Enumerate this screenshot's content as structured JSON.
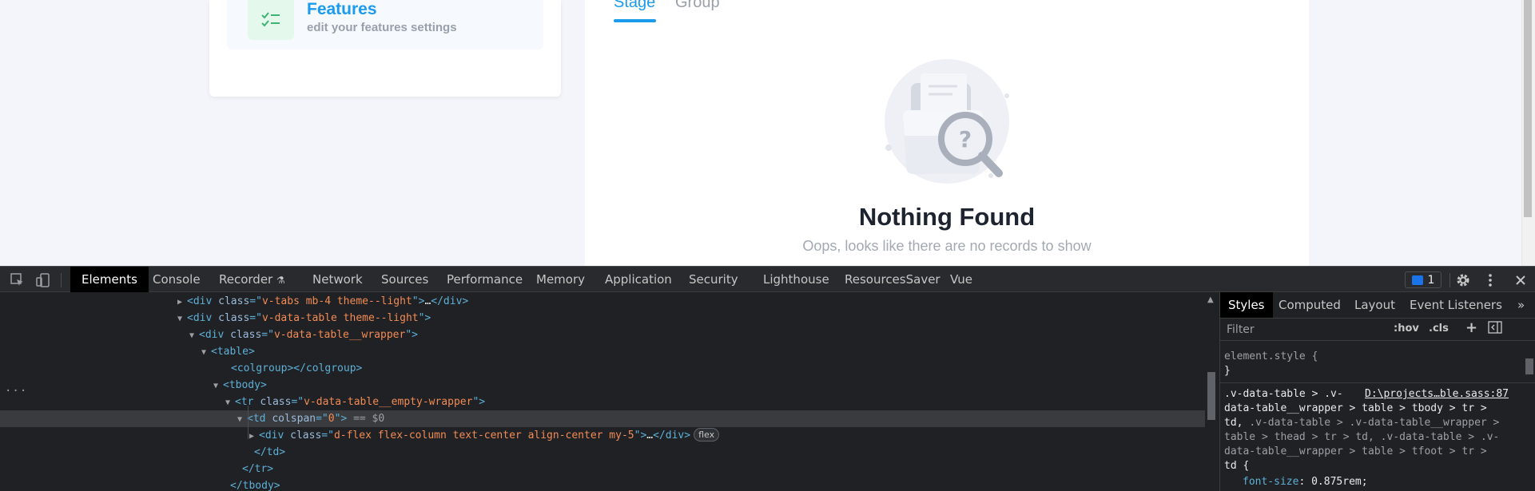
{
  "page": {
    "feature": {
      "title": "Features",
      "subtitle": "edit your features settings",
      "icon": "checklist-icon"
    },
    "tabs": [
      {
        "label": "Stage",
        "active": true
      },
      {
        "label": "Group",
        "active": false
      }
    ],
    "empty_state": {
      "title": "Nothing Found",
      "message": "Oops, looks like there are no records to show",
      "illustration": "folder-magnifier-question-icon"
    },
    "colors": {
      "accent": "#1a9bec",
      "feature_icon_bg": "#e5f8ec"
    }
  },
  "devtools": {
    "tabs": [
      {
        "label": "Elements",
        "active": true
      },
      {
        "label": "Console",
        "active": false
      },
      {
        "label": "Recorder",
        "active": false
      },
      {
        "label": "Network",
        "active": false
      },
      {
        "label": "Sources",
        "active": false
      },
      {
        "label": "Performance",
        "active": false
      },
      {
        "label": "Memory",
        "active": false
      },
      {
        "label": "Application",
        "active": false
      },
      {
        "label": "Security",
        "active": false
      },
      {
        "label": "Lighthouse",
        "active": false
      },
      {
        "label": "ResourcesSaver",
        "active": false
      },
      {
        "label": "Vue",
        "active": false
      }
    ],
    "issues_count": "1",
    "dom_lines": [
      {
        "open": "▶",
        "parts": [
          [
            "tag",
            "<div "
          ],
          [
            "attr",
            "class"
          ],
          [
            "tag",
            "=\""
          ],
          [
            "val",
            "v-tabs mb-4 theme--light"
          ],
          [
            "tag",
            "\">"
          ],
          [
            "txt",
            "…"
          ],
          [
            "tag",
            "</div>"
          ]
        ]
      },
      {
        "open": "▼",
        "parts": [
          [
            "tag",
            "<div "
          ],
          [
            "attr",
            "class"
          ],
          [
            "tag",
            "=\""
          ],
          [
            "val",
            "v-data-table theme--light"
          ],
          [
            "tag",
            "\">"
          ]
        ]
      },
      {
        "open": "▼",
        "parts": [
          [
            "tag",
            "<div "
          ],
          [
            "attr",
            "class"
          ],
          [
            "tag",
            "=\""
          ],
          [
            "val",
            "v-data-table__wrapper"
          ],
          [
            "tag",
            "\">"
          ]
        ]
      },
      {
        "open": "▼",
        "parts": [
          [
            "tag",
            "<table>"
          ]
        ]
      },
      {
        "open": "",
        "parts": [
          [
            "tag",
            "<colgroup></colgroup>"
          ]
        ]
      },
      {
        "open": "▼",
        "parts": [
          [
            "tag",
            "<tbody>"
          ]
        ]
      },
      {
        "open": "▼",
        "parts": [
          [
            "tag",
            "<tr "
          ],
          [
            "attr",
            "class"
          ],
          [
            "tag",
            "=\""
          ],
          [
            "val",
            "v-data-table__empty-wrapper"
          ],
          [
            "tag",
            "\">"
          ]
        ]
      },
      {
        "open": "▼",
        "parts": [
          [
            "tag",
            "<td "
          ],
          [
            "attr",
            "colspan"
          ],
          [
            "tag",
            "=\""
          ],
          [
            "val",
            "0"
          ],
          [
            "tag",
            "\">"
          ],
          [
            "dim",
            " == $0"
          ]
        ]
      },
      {
        "open": "▶",
        "parts": [
          [
            "tag",
            "<div "
          ],
          [
            "attr",
            "class"
          ],
          [
            "tag",
            "=\""
          ],
          [
            "val",
            "d-flex flex-column text-center align-center my-5"
          ],
          [
            "tag",
            "\">"
          ],
          [
            "txt",
            "…"
          ],
          [
            "tag",
            "</div>"
          ]
        ],
        "badge": "flex"
      },
      {
        "open": "",
        "parts": [
          [
            "tag",
            "</td>"
          ]
        ]
      },
      {
        "open": "",
        "parts": [
          [
            "tag",
            "</tr>"
          ]
        ]
      },
      {
        "open": "",
        "parts": [
          [
            "tag",
            "</tbody>"
          ]
        ]
      }
    ],
    "styles": {
      "tabs": [
        {
          "label": "Styles",
          "active": true
        },
        {
          "label": "Computed",
          "active": false
        },
        {
          "label": "Layout",
          "active": false
        },
        {
          "label": "Event Listeners",
          "active": false
        }
      ],
      "more_tabs": "»",
      "filter_placeholder": "Filter",
      "hov": ":hov",
      "cls": ".cls",
      "element_style_open": "element.style {",
      "element_style_close": "}",
      "rule_source": "D:\\projects…ble.sass:87",
      "rule_selector_1": ".v-data-table > .v-",
      "rule_selector_2": "data-table__wrapper > table > tbody > tr >",
      "rule_selector_3a": "td, ",
      "rule_selector_3b": ".v-data-table > .v-data-table__wrapper >",
      "rule_selector_4": "table > thead > tr > td, .v-data-table > .v-",
      "rule_selector_5": "data-table__wrapper > table > tfoot > tr >",
      "rule_selector_6": "td {",
      "prop_name": "font-size",
      "prop_value": "0.875rem;"
    }
  }
}
